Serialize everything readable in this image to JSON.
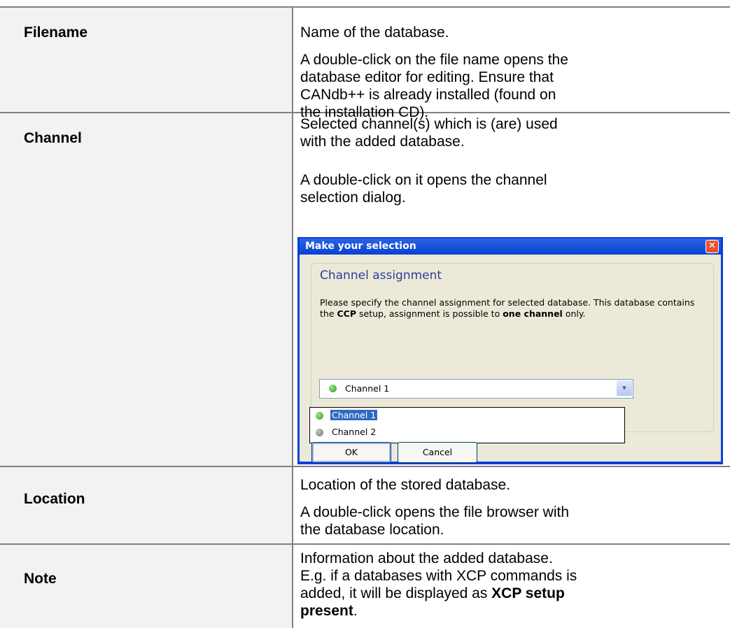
{
  "rows": [
    {
      "label": "Filename",
      "desc": [
        "Name of the database.",
        "A double-click on the file name opens the database editor for editing. Ensure that CANdb++ is already installed (found on the installation CD)."
      ]
    },
    {
      "label": "Channel",
      "desc": [
        "Selected channel(s) which is (are) used with the added database.",
        "A double-click on it opens the channel selection dialog."
      ]
    },
    {
      "label": "Location",
      "desc": [
        "Location of the stored database.",
        "A double-click opens the file browser with the database location."
      ]
    },
    {
      "label": "Note",
      "desc_prefix": "Information about the added database. E.g. if a databases with XCP commands is added, it will be displayed as ",
      "desc_bold": "XCP setup present",
      "desc_suffix": "."
    }
  ],
  "dialog": {
    "title": "Make your selection",
    "close_glyph": "✕",
    "group_title": "Channel assignment",
    "text_1": "Please specify the channel assignment for selected database. This database contains the ",
    "text_bold_1": "CCP",
    "text_2": " setup, assignment is possible to ",
    "text_bold_2": "one channel",
    "text_3": " only.",
    "combo_value": "Channel 1",
    "combo_arrow": "▾",
    "options": [
      "Channel 1",
      "Channel 2"
    ],
    "ok_label": "OK",
    "cancel_label": "Cancel",
    "colors": {
      "titlebar": "#0a43d4",
      "body": "#ece9d8",
      "selection": "#316ac5",
      "status_active": "#27a01d",
      "status_inactive": "#6f6f6f"
    }
  }
}
